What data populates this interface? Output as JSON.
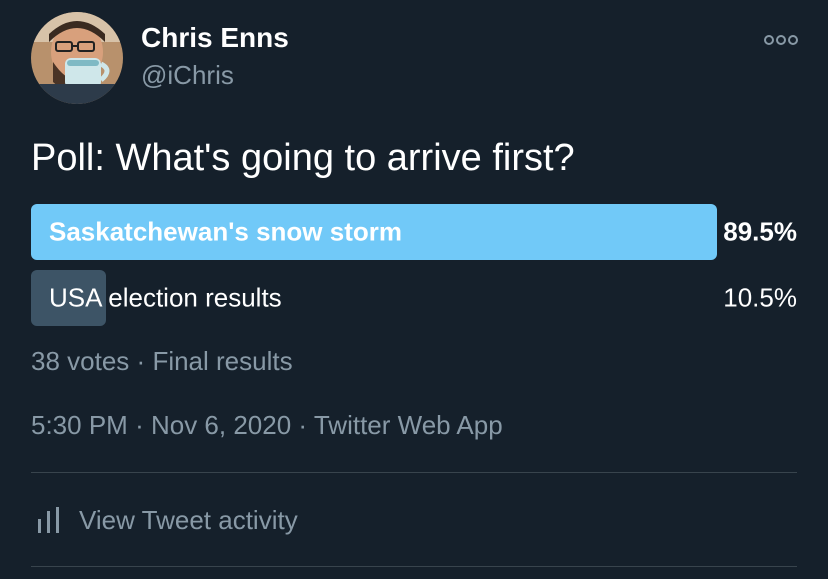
{
  "author": {
    "display_name": "Chris Enns",
    "handle": "@iChris",
    "avatar_icon": "avatar-photo"
  },
  "tweet": {
    "text": "Poll: What's going to arrive first?"
  },
  "poll": {
    "options": [
      {
        "label": "Saskatchewan's snow storm",
        "percent_text": "89.5%",
        "percent": 89.5,
        "color": "#71c9f8"
      },
      {
        "label": "USA election results",
        "percent_text": "10.5%",
        "percent": 10.5,
        "color": "#3d5466"
      }
    ],
    "votes": "38 votes",
    "separator": "·",
    "status": "Final results"
  },
  "meta": {
    "time": "5:30 PM",
    "separator": "·",
    "date": "Nov 6, 2020",
    "source": "Twitter Web App"
  },
  "actions": {
    "activity_label": "View Tweet activity",
    "activity_icon": "bar-chart-icon",
    "more_icon": "more-options-icon"
  },
  "colors": {
    "background": "#15202b",
    "secondary_text": "#8899a6",
    "accent": "#71c9f8",
    "divider": "#38444d"
  }
}
